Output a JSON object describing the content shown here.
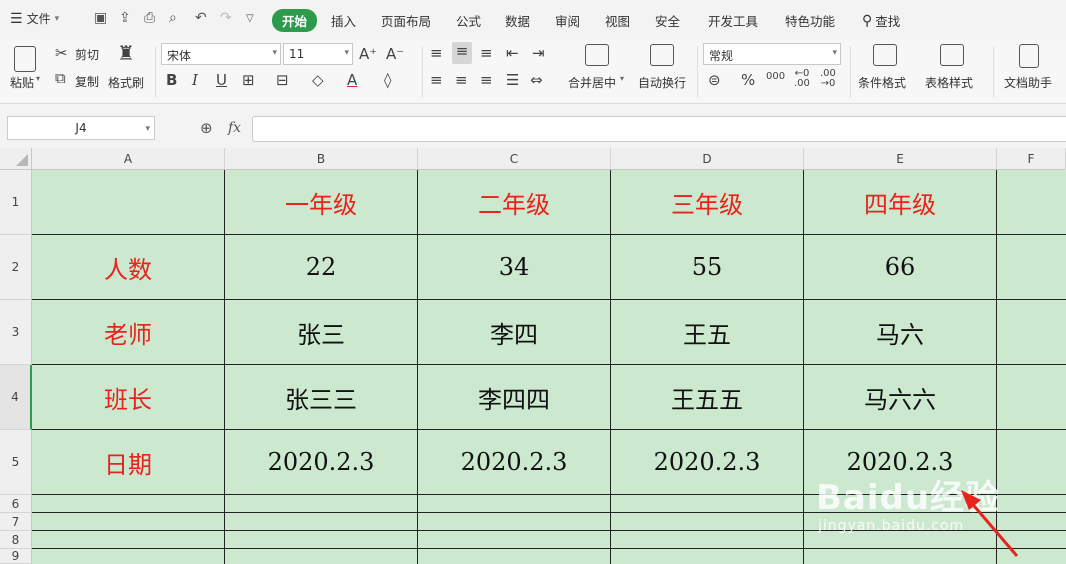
{
  "menubar": {
    "file_label": "文件",
    "tabs": [
      "开始",
      "插入",
      "页面布局",
      "公式",
      "数据",
      "审阅",
      "视图",
      "安全",
      "开发工具",
      "特色功能"
    ],
    "active_tab": "开始",
    "search_label": "查找"
  },
  "ribbon": {
    "paste": "粘贴",
    "cut": "剪切",
    "copy": "复制",
    "format_painter": "格式刷",
    "font_name": "宋体",
    "font_size": "11",
    "merge_center": "合并居中",
    "wrap_text": "自动换行",
    "number_format": "常规",
    "conditional_format": "条件格式",
    "table_style": "表格样式",
    "doc_helper": "文档助手",
    "percent_symbol": "%",
    "thousands_symbol": "000"
  },
  "formula_bar": {
    "name_box": "J4",
    "fx_label": "fx",
    "formula": ""
  },
  "sheet": {
    "columns": [
      "A",
      "B",
      "C",
      "D",
      "E",
      "F"
    ],
    "rows": [
      "1",
      "2",
      "3",
      "4",
      "5",
      "6",
      "7",
      "8",
      "9"
    ],
    "selected_row": "4",
    "cells": {
      "A1": "",
      "B1": "一年级",
      "C1": "二年级",
      "D1": "三年级",
      "E1": "四年级",
      "A2": "人数",
      "B2": "22",
      "C2": "34",
      "D2": "55",
      "E2": "66",
      "A3": "老师",
      "B3": "张三",
      "C3": "李四",
      "D3": "王五",
      "E3": "马六",
      "A4": "班长",
      "B4": "张三三",
      "C4": "李四四",
      "D4": "王五五",
      "E4": "马六六",
      "A5": "日期",
      "B5": "2020.2.3",
      "C5": "2020.2.3",
      "D5": "2020.2.3",
      "E5": "2020.2.3"
    },
    "cell_fill": "#cce8cf",
    "header_text_color": "#e8231c"
  },
  "watermark": {
    "logo": "Baidu经验",
    "url": "jingyan.baidu.com"
  },
  "colors": {
    "accent": "#2e9a4b",
    "arrow": "#e8231c"
  }
}
